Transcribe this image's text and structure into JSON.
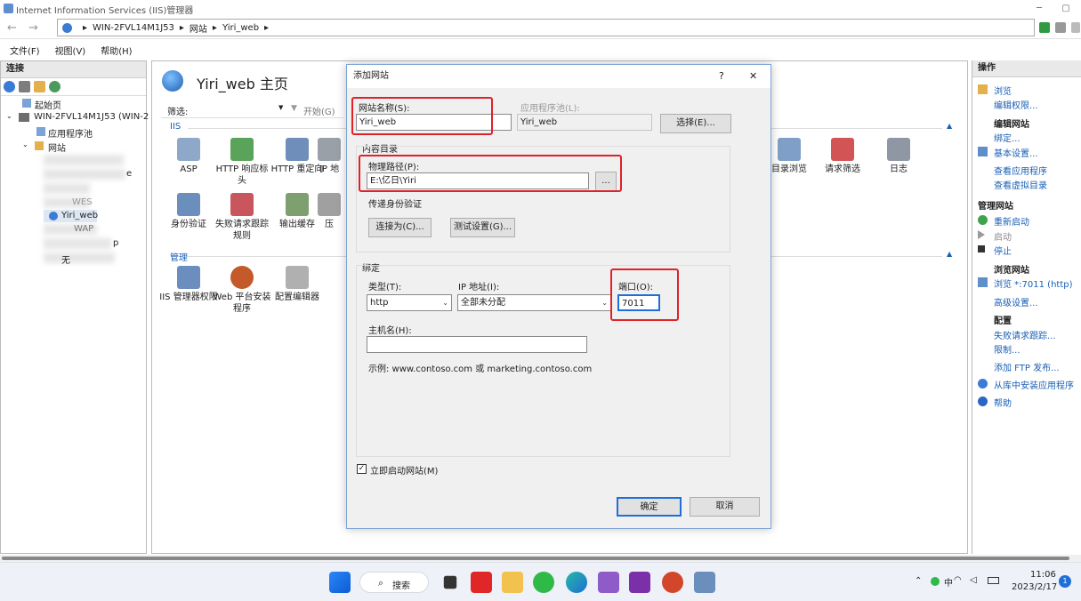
{
  "window": {
    "title": "Internet Information Services (IIS)管理器",
    "min": "─",
    "max": "▢"
  },
  "address": {
    "segments": [
      "WIN-2FVL14M1J53",
      "网站",
      "Yiri_web"
    ],
    "sep": "▸"
  },
  "menu": {
    "file": "文件(F)",
    "view": "视图(V)",
    "help": "帮助(H)"
  },
  "left_panel": {
    "header": "连接",
    "tree": {
      "start": "起始页",
      "server": "WIN-2FVL14M1J53 (WIN-2",
      "app_pools": "应用程序池",
      "sites": "网站",
      "site_yiri": "Yiri_web",
      "partial_1": "e",
      "partial_2": "WES",
      "partial_3": "WAP",
      "partial_4": "p",
      "partial_5": "无"
    }
  },
  "center": {
    "title": "Yiri_web 主页",
    "filter_label": "筛选:",
    "start_label": "开始(G)",
    "iis_section": "IIS",
    "manage_section": "管理",
    "features_row1": [
      "ASP",
      "HTTP 响应标头",
      "HTTP 重定向",
      "IP 地"
    ],
    "features_row2": [
      "身份验证",
      "失败请求跟踪规则",
      "输出缓存",
      "压"
    ],
    "features_right": [
      "目录浏览",
      "请求筛选",
      "日志"
    ],
    "features_manage": [
      "IIS 管理器权限",
      "Web 平台安装程序",
      "配置编辑器"
    ]
  },
  "dialog": {
    "title": "添加网站",
    "help": "?",
    "close": "✕",
    "site_name_label": "网站名称(S):",
    "site_name_value": "Yiri_web",
    "app_pool_label": "应用程序池(L):",
    "app_pool_value": "Yiri_web",
    "select_button": "选择(E)...",
    "content_dir_label": "内容目录",
    "physical_path_label": "物理路径(P):",
    "physical_path_value": "E:\\亿日\\Yiri",
    "browse_button": "...",
    "pass_auth_label": "传递身份验证",
    "connect_as_button": "连接为(C)...",
    "test_settings_button": "测试设置(G)...",
    "binding_label": "绑定",
    "type_label": "类型(T):",
    "type_value": "http",
    "ip_label": "IP 地址(I):",
    "ip_value": "全部未分配",
    "port_label": "端口(O):",
    "port_value": "7011",
    "host_label": "主机名(H):",
    "host_value": "",
    "example_text": "示例: www.contoso.com 或 marketing.contoso.com",
    "start_now_label": "立即启动网站(M)",
    "start_now_checked": true,
    "ok_button": "确定",
    "cancel_button": "取消"
  },
  "right_panel": {
    "header": "操作",
    "browse": "浏览",
    "edit_perms": "编辑权限...",
    "edit_site_header": "编辑网站",
    "bindings": "绑定...",
    "basic_settings": "基本设置...",
    "view_apps": "查看应用程序",
    "view_vdirs": "查看虚拟目录",
    "manage_site_header": "管理网站",
    "restart": "重新启动",
    "start": "启动",
    "stop": "停止",
    "browse_site_header": "浏览网站",
    "browse_port": "浏览 *:7011 (http)",
    "advanced_settings": "高级设置...",
    "config_header": "配置",
    "failed_request_tracing": "失败请求跟踪...",
    "limits": "限制...",
    "add_ftp": "添加 FTP 发布...",
    "install_from_gallery": "从库中安装应用程序",
    "help": "帮助"
  },
  "taskbar": {
    "search": "搜索",
    "time": "11:06",
    "date": "2023/2/17",
    "notif_count": "1",
    "ime": "中"
  }
}
